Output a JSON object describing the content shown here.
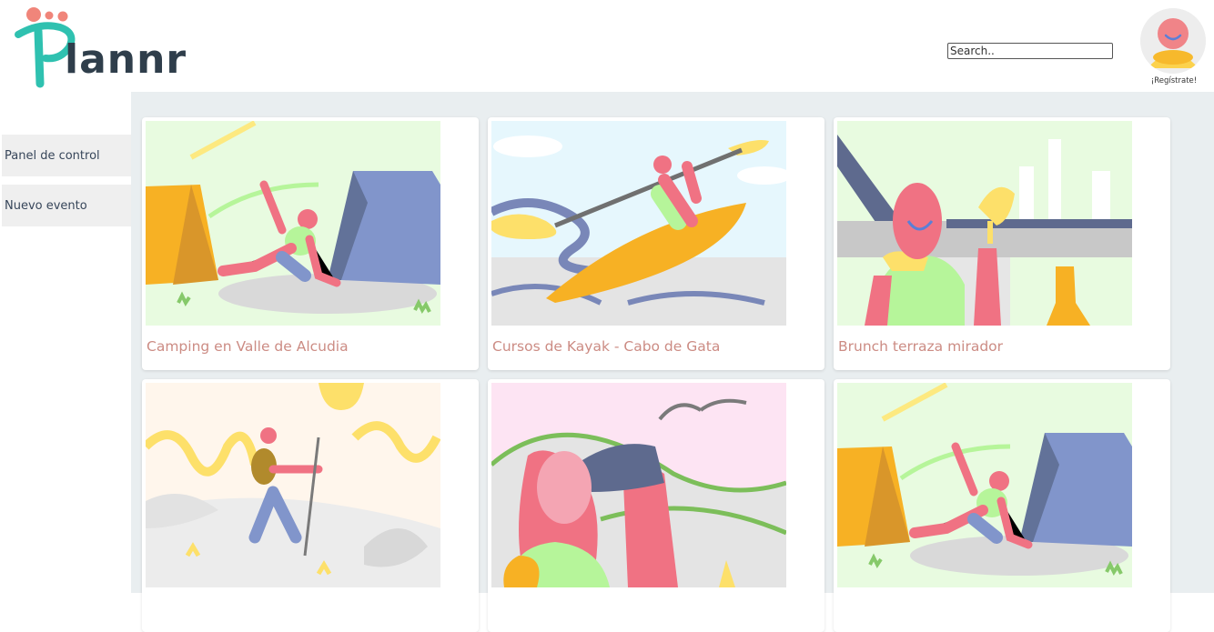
{
  "app": {
    "logo_text": "lannr",
    "brand_colors": {
      "teal": "#2fc1b0",
      "coral": "#f0857a",
      "dark": "#2f3e4b"
    }
  },
  "header": {
    "search": {
      "placeholder": "Search..",
      "value": ""
    },
    "account": {
      "label": "¡Regístrate!"
    }
  },
  "sidebar": {
    "items": [
      {
        "label": "Panel de control"
      },
      {
        "label": "Nuevo evento"
      }
    ]
  },
  "events": [
    {
      "title": "Camping en Valle de Alcudia",
      "illustration": "camping-tent"
    },
    {
      "title": "Cursos de Kayak - Cabo de Gata",
      "illustration": "kayak"
    },
    {
      "title": "Brunch terraza mirador",
      "illustration": "brunch-toast"
    },
    {
      "title": "",
      "illustration": "hiking"
    },
    {
      "title": "",
      "illustration": "binoculars"
    },
    {
      "title": "",
      "illustration": "camping-tent"
    }
  ]
}
